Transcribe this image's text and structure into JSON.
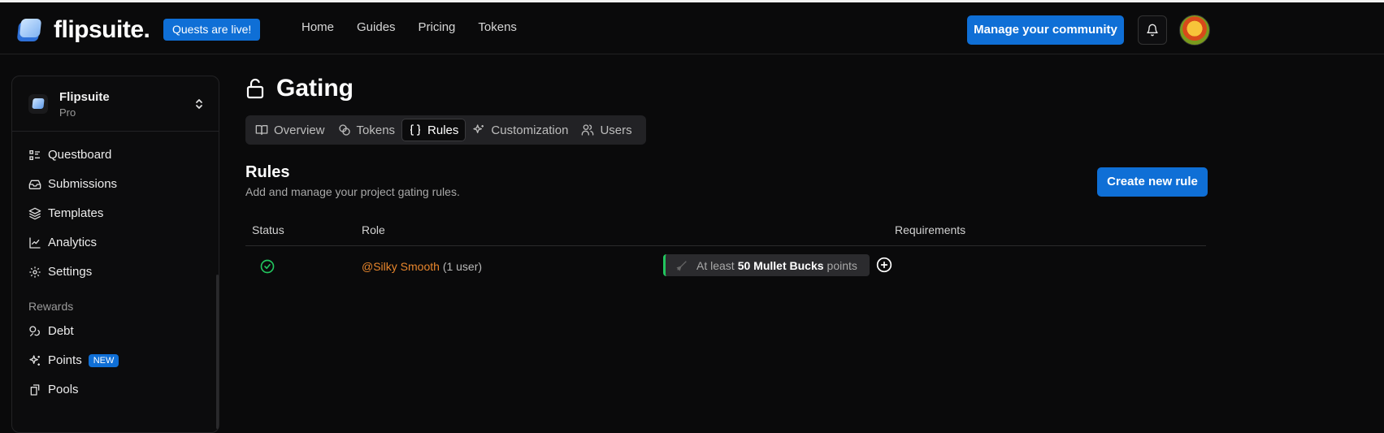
{
  "header": {
    "logo_text": "flipsuite.",
    "quest_badge": "Quests are live!",
    "nav": [
      "Home",
      "Guides",
      "Pricing",
      "Tokens"
    ],
    "manage_button": "Manage your community",
    "icons": {
      "bell": "bell-icon",
      "avatar": "user-avatar"
    }
  },
  "sidebar": {
    "org_name": "Flipsuite",
    "org_plan": "Pro",
    "items": [
      {
        "label": "Questboard",
        "icon": "list-icon"
      },
      {
        "label": "Submissions",
        "icon": "inbox-icon"
      },
      {
        "label": "Templates",
        "icon": "layers-icon"
      },
      {
        "label": "Analytics",
        "icon": "chart-icon"
      },
      {
        "label": "Settings",
        "icon": "gear-icon"
      }
    ],
    "rewards_label": "Rewards",
    "rewards": [
      {
        "label": "Debt",
        "icon": "coins-icon"
      },
      {
        "label": "Points",
        "icon": "sparkles-icon",
        "badge": "NEW"
      },
      {
        "label": "Pools",
        "icon": "pool-icon"
      }
    ]
  },
  "page": {
    "title": "Gating",
    "tabs": [
      {
        "label": "Overview",
        "active": false
      },
      {
        "label": "Tokens",
        "active": false
      },
      {
        "label": "Rules",
        "active": true
      },
      {
        "label": "Customization",
        "active": false
      },
      {
        "label": "Users",
        "active": false
      }
    ],
    "section_title": "Rules",
    "section_subtitle": "Add and manage your project gating rules.",
    "create_button": "Create new rule"
  },
  "table": {
    "headers": [
      "Status",
      "Role",
      "Requirements"
    ],
    "rows": [
      {
        "status": "active",
        "role_name": "@Silky Smooth",
        "role_count": "(1 user)",
        "req_prefix": "At least",
        "req_value": "50 Mullet Bucks",
        "req_suffix": "points"
      }
    ]
  },
  "colors": {
    "accent": "#0f6fd6",
    "role": "#e8862c",
    "success": "#22c55e"
  }
}
